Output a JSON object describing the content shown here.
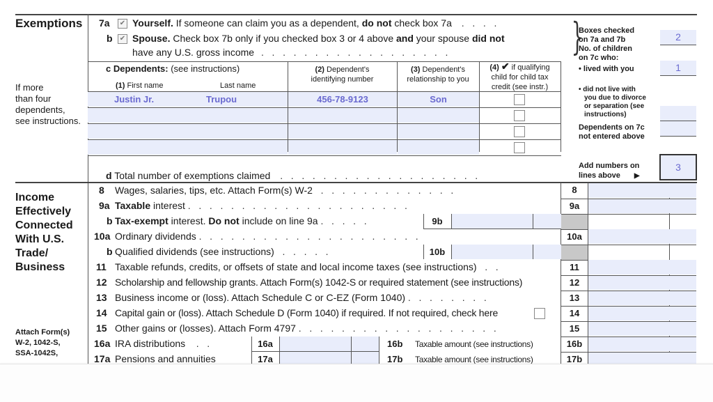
{
  "exemptions": {
    "heading": "Exemptions",
    "side_note": [
      "If more",
      "than four",
      "dependents,",
      "see instructions."
    ],
    "line7a": {
      "num": "7a",
      "checked": true,
      "bold": "Yourself.",
      "text1": " If someone can claim you as a dependent, ",
      "bold2": "do not",
      "text2": " check box 7a",
      "dots": ".   .   .   ."
    },
    "line7b": {
      "num": "b",
      "checked": true,
      "bold": "Spouse.",
      "text1": " Check box 7b only if you checked box 3 or 4 above ",
      "bold2": "and",
      "text2": " your spouse ",
      "bold3": "did not",
      "text3": "have any U.S. gross income",
      "dots": ".   .   .   .   .   .   .   .   .   .   .   .   .   .   .   .   .   ."
    },
    "line7c": {
      "label_num": "c",
      "label_bold": "Dependents:",
      "label_text": " (see instructions)",
      "col1_num": "(1)",
      "col1_first": " First name",
      "col1_last": "Last name",
      "col2_num": "(2)",
      "col2_text": " Dependent's",
      "col2_text2": "identifying number",
      "col3_num": "(3)",
      "col3_text": " Dependent's",
      "col3_text2": "relationship to you",
      "col4_num": "(4)",
      "col4_check": "✔",
      "col4_text": " if qualifying",
      "col4_text2": "child for child tax",
      "col4_text3": "credit (see instr.)",
      "rows": [
        {
          "first": "Justin Jr.",
          "last": "Trupou",
          "id": "456-78-9123",
          "relationship": "Son",
          "qualifying": false
        },
        {
          "first": "",
          "last": "",
          "id": "",
          "relationship": "",
          "qualifying": false
        },
        {
          "first": "",
          "last": "",
          "id": "",
          "relationship": "",
          "qualifying": false
        },
        {
          "first": "",
          "last": "",
          "id": "",
          "relationship": "",
          "qualifying": false
        }
      ]
    },
    "line7d": {
      "num": "d",
      "text": "Total number of exemptions claimed",
      "dots": ".   .   .   .   .   .   .   .   .   .   .   .   .   .   .   .   .   .   ."
    },
    "right": {
      "boxes_checked_label": [
        "Boxes checked",
        "on 7a and 7b"
      ],
      "boxes_checked_value": "2",
      "children_label": [
        "No. of children",
        "on 7c who:"
      ],
      "lived_with_label": "• lived with you",
      "lived_with_value": "1",
      "did_not_live_label": [
        "• did not live with",
        "you due to divorce",
        "or separation (see",
        "instructions)"
      ],
      "did_not_live_value": "",
      "not_entered_label": [
        "Dependents on 7c",
        "not entered above"
      ],
      "not_entered_value": "",
      "add_label": [
        "Add numbers on",
        "lines above"
      ],
      "add_arrow": "▶",
      "add_value": "3"
    }
  },
  "income": {
    "heading": [
      "Income",
      "Effectively",
      "Connected",
      "With U.S.",
      "Trade/",
      "Business"
    ],
    "attach_note": [
      "Attach Form(s)",
      "W-2, 1042-S,",
      "SSA-1042S,"
    ],
    "lines": [
      {
        "num": "8",
        "text": "Wages, salaries, tips, etc. Attach Form(s) W-2",
        "box": "8",
        "value": ""
      },
      {
        "num": "9a",
        "bold": "Taxable",
        "text": " interest",
        "box": "9a",
        "value": ""
      },
      {
        "num": "b",
        "bold": "Tax-exempt",
        "text": " interest. ",
        "bold2": "Do not",
        "text2": " include on line 9a",
        "inner_box": "9b",
        "value": ""
      },
      {
        "num": "10a",
        "text": "Ordinary dividends",
        "box": "10a",
        "value": ""
      },
      {
        "num": "b",
        "text": "Qualified dividends (see instructions)",
        "inner_box": "10b",
        "value": ""
      },
      {
        "num": "11",
        "text": "Taxable refunds, credits, or offsets of state and local income taxes (see instructions)",
        "box": "11",
        "value": ""
      },
      {
        "num": "12",
        "text": "Scholarship and fellowship grants. Attach Form(s) 1042-S or required statement (see instructions)",
        "box": "12",
        "value": ""
      },
      {
        "num": "13",
        "text": "Business income or (loss). Attach Schedule C or C-EZ (Form 1040)",
        "box": "13",
        "value": ""
      },
      {
        "num": "14",
        "text": "Capital gain or (loss). Attach Schedule D (Form 1040) if required. If not required, check here",
        "box": "14",
        "checked": false,
        "value": ""
      },
      {
        "num": "15",
        "text": "Other gains or (losses). Attach Form 4797",
        "box": "15",
        "value": ""
      },
      {
        "num": "16a",
        "text": "IRA distributions",
        "inner_box": "16a",
        "b_num": "16b",
        "b_text": "Taxable amount (see instructions)",
        "box": "16b",
        "value": ""
      },
      {
        "num": "17a",
        "text": "Pensions and annuities",
        "inner_box": "17a",
        "b_num": "17b",
        "b_text": "Taxable amount (see instructions)",
        "box": "17b",
        "value": ""
      }
    ]
  }
}
